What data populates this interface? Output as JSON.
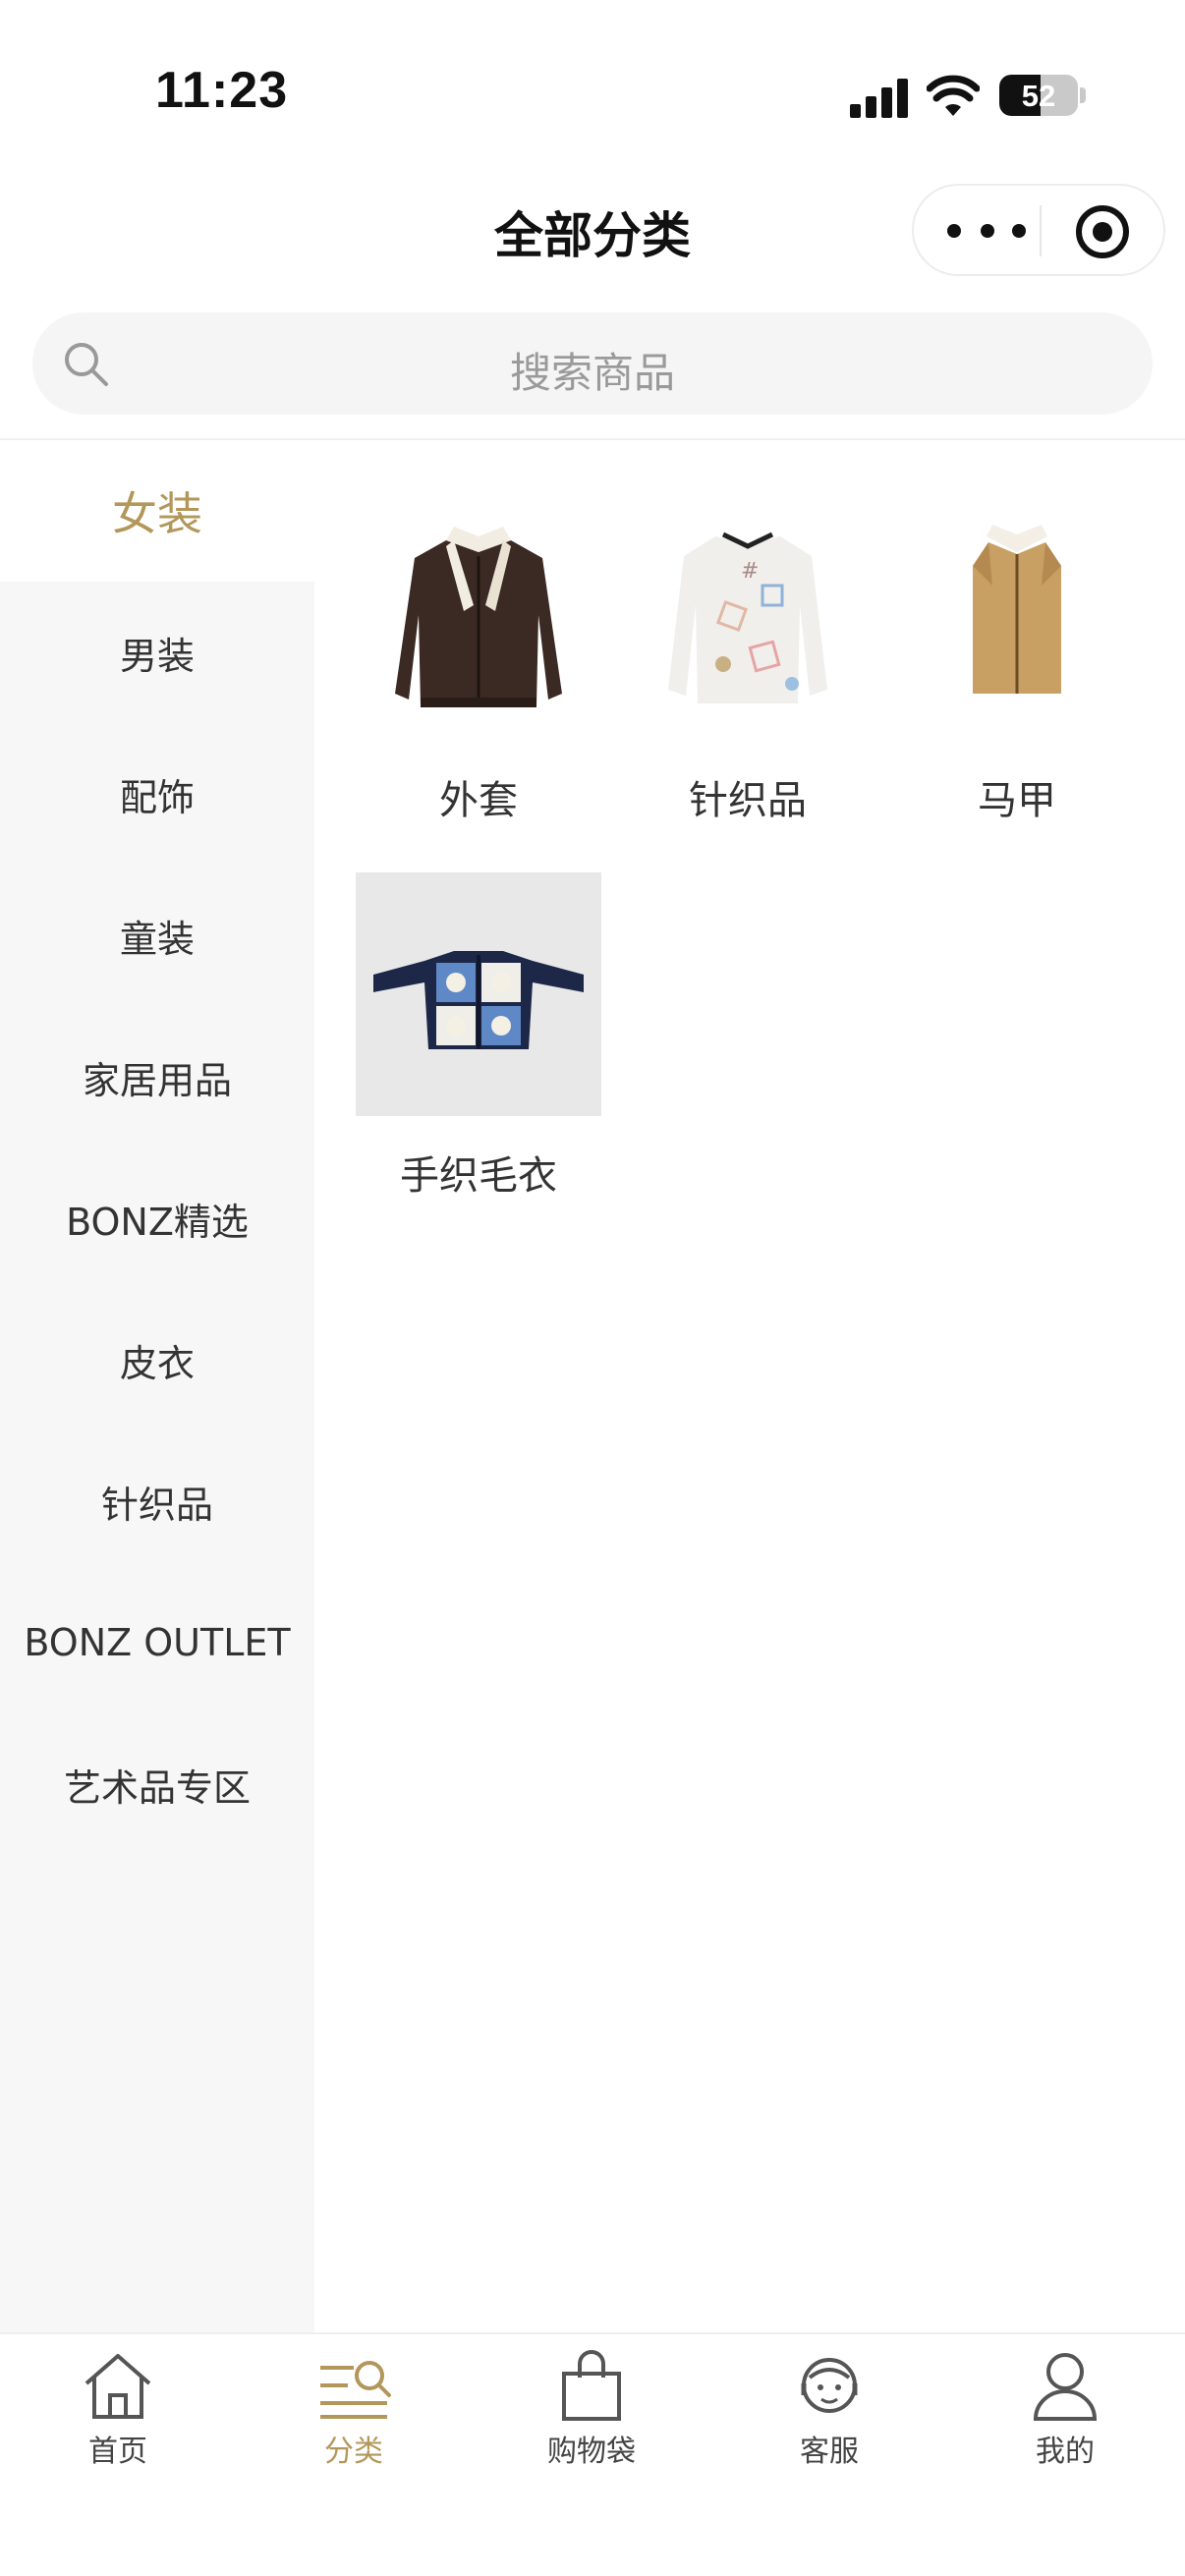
{
  "status_bar": {
    "time": "11:23",
    "battery": "52",
    "battery_level": 0.52
  },
  "nav": {
    "title": "全部分类"
  },
  "search": {
    "placeholder": "搜索商品"
  },
  "sidebar": {
    "items": [
      {
        "label": "女装",
        "active": true
      },
      {
        "label": "男装"
      },
      {
        "label": "配饰"
      },
      {
        "label": "童装"
      },
      {
        "label": "家居用品"
      },
      {
        "label": "BONZ精选"
      },
      {
        "label": "皮衣"
      },
      {
        "label": "针织品"
      },
      {
        "label": "BONZ OUTLET"
      },
      {
        "label": "艺术品专区"
      }
    ]
  },
  "categories": [
    {
      "label": "外套",
      "image": "leather-jacket"
    },
    {
      "label": "针织品",
      "image": "patterned-sweater"
    },
    {
      "label": "马甲",
      "image": "shearling-vest"
    },
    {
      "label": "手织毛衣",
      "image": "hand-knit-cardigan"
    }
  ],
  "tabbar": {
    "items": [
      {
        "label": "首页",
        "icon": "home-icon"
      },
      {
        "label": "分类",
        "icon": "category-icon",
        "active": true
      },
      {
        "label": "购物袋",
        "icon": "shopping-bag-icon"
      },
      {
        "label": "客服",
        "icon": "customer-service-icon"
      },
      {
        "label": "我的",
        "icon": "profile-icon"
      }
    ]
  },
  "colors": {
    "accent": "#b3975a",
    "sidebar_bg": "#f7f7f7",
    "search_bg": "#f5f5f5"
  }
}
